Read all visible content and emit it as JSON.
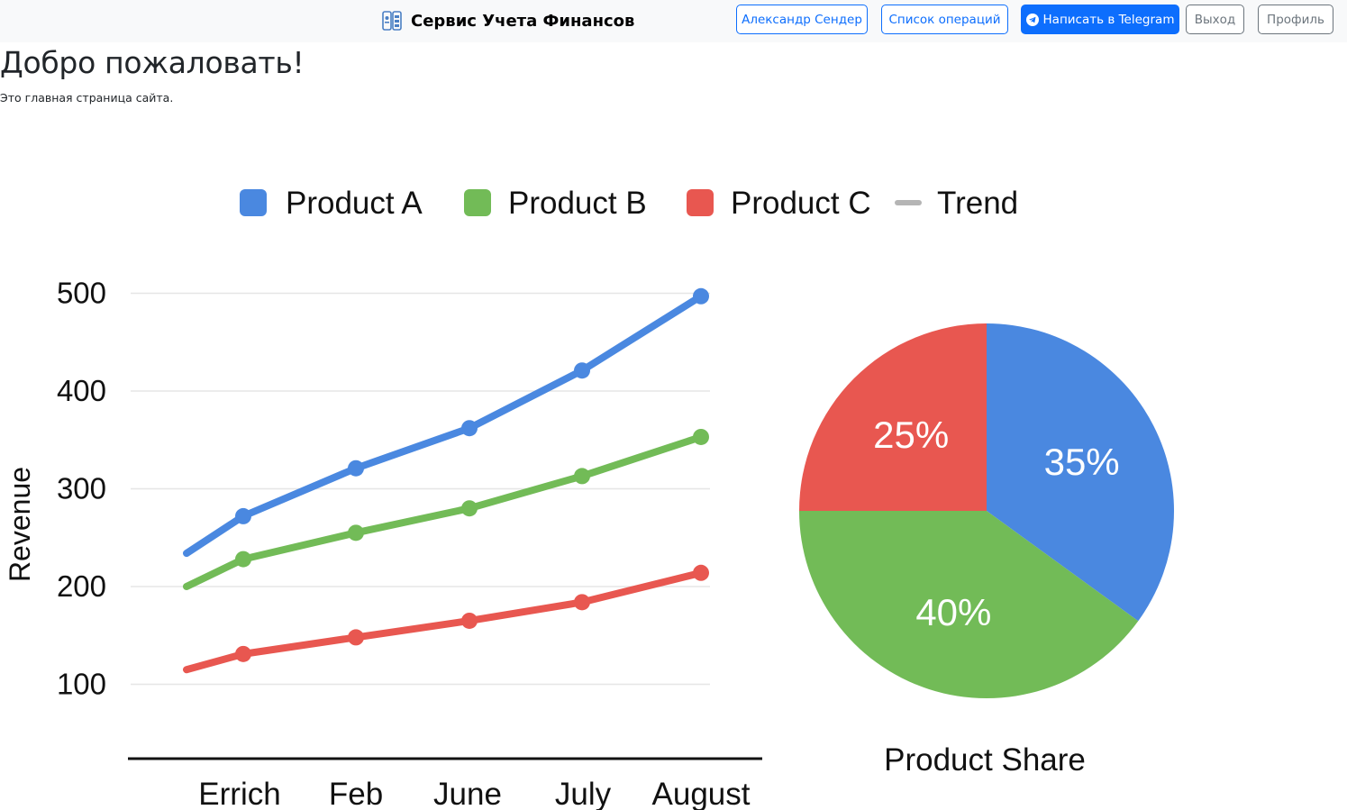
{
  "navbar": {
    "brand_icon": "finance-app-icon",
    "brand_title": "Сервис Учета Финансов",
    "buttons": {
      "user": "Александр Сендер",
      "operations": "Список операций",
      "telegram": "Написать в Telegram",
      "logout": "Выход",
      "profile": "Профиль"
    },
    "colors": {
      "primary": "#0d6efd",
      "secondary": "#6c757d",
      "background": "#f8f9fa"
    }
  },
  "main": {
    "title": "Добро пожаловать!",
    "subtitle": "Это главная страница сайта."
  },
  "chart_data": [
    {
      "type": "line",
      "categories": [
        "",
        "Errich",
        "Feb",
        "June",
        "July",
        "August"
      ],
      "x_tick_labels": [
        "Errich",
        "Feb",
        "June",
        "July",
        "August"
      ],
      "ylabel": "Revenue",
      "xlabel": "",
      "ylim": [
        100,
        500
      ],
      "y_ticks": [
        100,
        200,
        300,
        400,
        500
      ],
      "grid": true,
      "legend": {
        "placement": "top-center"
      },
      "series": [
        {
          "name": "Product A",
          "color": "#4a88e0",
          "values": [
            234,
            272,
            321,
            362,
            421,
            497
          ]
        },
        {
          "name": "Product B",
          "color": "#72bb57",
          "values": [
            200,
            228,
            255,
            280,
            313,
            353
          ]
        },
        {
          "name": "Product C",
          "color": "#e85750",
          "values": [
            115,
            131,
            148,
            165,
            184,
            214
          ]
        }
      ],
      "trend": {
        "name": "Trend",
        "color": "#b5b5b5"
      }
    },
    {
      "type": "pie",
      "title": "Product Share",
      "slices": [
        {
          "label": "35%",
          "value": 35,
          "color": "#4a88e0"
        },
        {
          "label": "40%",
          "value": 40,
          "color": "#72bb57"
        },
        {
          "label": "25%",
          "value": 25,
          "color": "#e85750"
        }
      ]
    }
  ]
}
